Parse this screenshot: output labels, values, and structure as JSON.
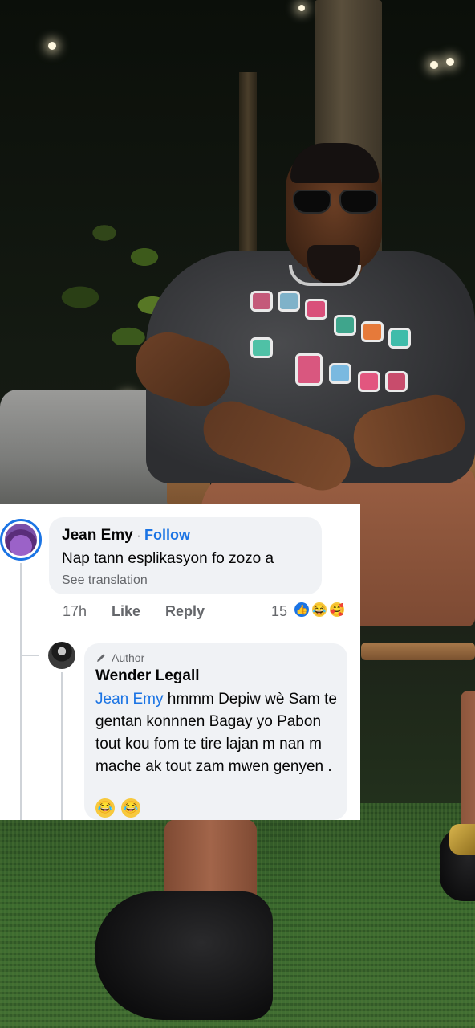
{
  "comment": {
    "author": "Jean Emy",
    "separator": "·",
    "follow_label": "Follow",
    "text": "Nap tann esplikasyon fo zozo a",
    "see_translation": "See translation",
    "time": "17h",
    "like_label": "Like",
    "reply_label": "Reply",
    "reaction_count": "15",
    "reactions": [
      "like-icon",
      "haha-icon",
      "care-icon"
    ]
  },
  "reply": {
    "badge_label": "Author",
    "author": "Wender Legall",
    "mention": "Jean Emy",
    "text": " hmmm Depiw wè Sam te gentan konnnen Bagay yo Pabon tout kou fom te tire lajan m nan m mache ak tout zam mwen genyen .",
    "emojis": [
      "😂",
      "😂"
    ]
  },
  "colors": {
    "link_blue": "#1b74e4",
    "bubble_bg": "#f0f2f5",
    "muted_text": "#65676b"
  }
}
